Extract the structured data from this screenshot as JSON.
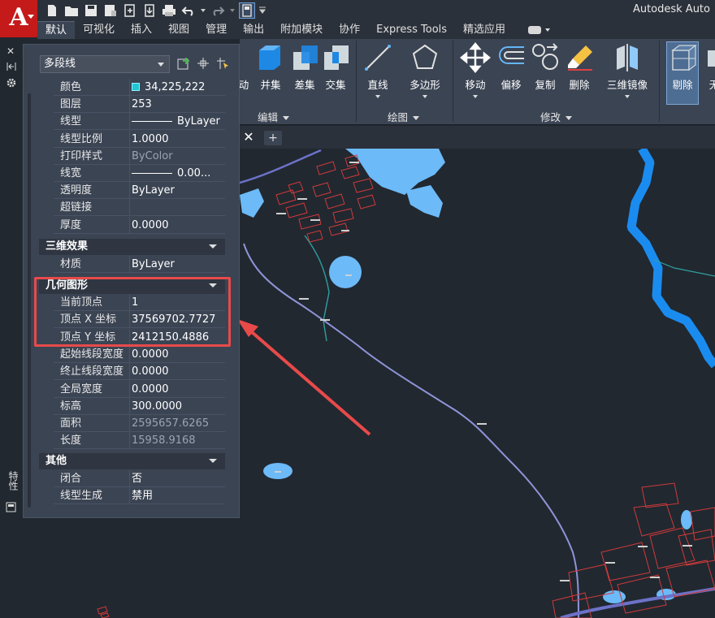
{
  "app": {
    "title": "Autodesk Auto",
    "logo_letter": "A"
  },
  "ribbon_tabs": [
    "默认",
    "可视化",
    "插入",
    "视图",
    "管理",
    "输出",
    "附加模块",
    "协作",
    "Express Tools",
    "精选应用"
  ],
  "ribbon": {
    "buttons": {
      "partial": "动",
      "union": "并集",
      "subtract": "差集",
      "intersect": "交集",
      "line": "直线",
      "polygon": "多边形",
      "move": "移动",
      "offset": "偏移",
      "copy": "复制",
      "erase": "删除",
      "mirror3d": "三维镜像",
      "slice": "剔除",
      "cut": "无"
    },
    "panels": {
      "edit": "编辑",
      "draw": "绘图",
      "modify": "修改"
    }
  },
  "palette": {
    "object_type": "多段线",
    "side_label": "特性",
    "general": [
      {
        "key": "颜色",
        "value": "34,225,222",
        "swatch": "#1ec7d2"
      },
      {
        "key": "图层",
        "value": "253"
      },
      {
        "key": "线型",
        "value": "ByLayer",
        "line": true
      },
      {
        "key": "线型比例",
        "value": "1.0000"
      },
      {
        "key": "打印样式",
        "value": "ByColor",
        "dim": true
      },
      {
        "key": "线宽",
        "value": "0.00...",
        "line": true
      },
      {
        "key": "透明度",
        "value": "ByLayer"
      },
      {
        "key": "超链接",
        "value": ""
      },
      {
        "key": "厚度",
        "value": "0.0000"
      }
    ],
    "section_3d": "三维效果",
    "effects": [
      {
        "key": "材质",
        "value": "ByLayer"
      }
    ],
    "section_geometry": "几何图形",
    "geometry": [
      {
        "key": "当前顶点",
        "value": "1"
      },
      {
        "key": "顶点 X 坐标",
        "value": "37569702.7727"
      },
      {
        "key": "顶点 Y 坐标",
        "value": "2412150.4886"
      },
      {
        "key": "起始线段宽度",
        "value": "0.0000"
      },
      {
        "key": "终止线段宽度",
        "value": "0.0000"
      },
      {
        "key": "全局宽度",
        "value": "0.0000"
      },
      {
        "key": "标高",
        "value": "300.0000"
      },
      {
        "key": "面积",
        "value": "2595657.6265",
        "dim": true
      },
      {
        "key": "长度",
        "value": "15958.9168",
        "dim": true
      }
    ],
    "section_misc": "其他",
    "misc": [
      {
        "key": "闭合",
        "value": "否"
      },
      {
        "key": "线型生成",
        "value": "禁用"
      }
    ]
  },
  "colors": {
    "water": "#6cbaf8",
    "river": "#1a8cf0",
    "parcel": "#d03a3a",
    "road": "#6c72c8",
    "polyline": "#8f94d8",
    "highlight": "#e84a4a"
  }
}
